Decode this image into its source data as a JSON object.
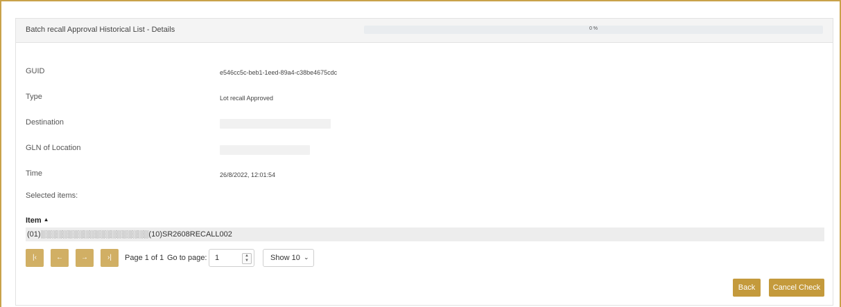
{
  "header": {
    "title": "Batch recall Approval Historical List - Details",
    "progress_value": 0,
    "progress_text": "0 %"
  },
  "details": {
    "guid": {
      "label": "GUID",
      "value": "e546cc5c-beb1-1eed-89a4-c38be4675cdc"
    },
    "type": {
      "label": "Type",
      "value": "Lot recall Approved"
    },
    "destination": {
      "label": "Destination",
      "value": "[redacted]"
    },
    "gln": {
      "label": "GLN of Location",
      "value": "[redacted]"
    },
    "time": {
      "label": "Time",
      "value": "26/8/2022, 12:01:54"
    },
    "selected_label": "Selected items:"
  },
  "table": {
    "column_header": "Item",
    "sort_icon": "▲",
    "rows": [
      "(01)░░░░░░░░░░░░░░░░░░░░(10)SR2608RECALL002"
    ]
  },
  "pagination": {
    "first_icon": "|‹",
    "prev_icon": "←",
    "next_icon": "→",
    "last_icon": "›|",
    "page_text": "Page 1 of 1",
    "goto_label": "Go to page:",
    "page_input_value": "1",
    "show_select_value": "Show 10"
  },
  "actions": {
    "back_label": "Back",
    "cancel_check_label": "Cancel Check"
  },
  "colors": {
    "accent": "#c49a3c",
    "frame": "#c9a24a"
  }
}
